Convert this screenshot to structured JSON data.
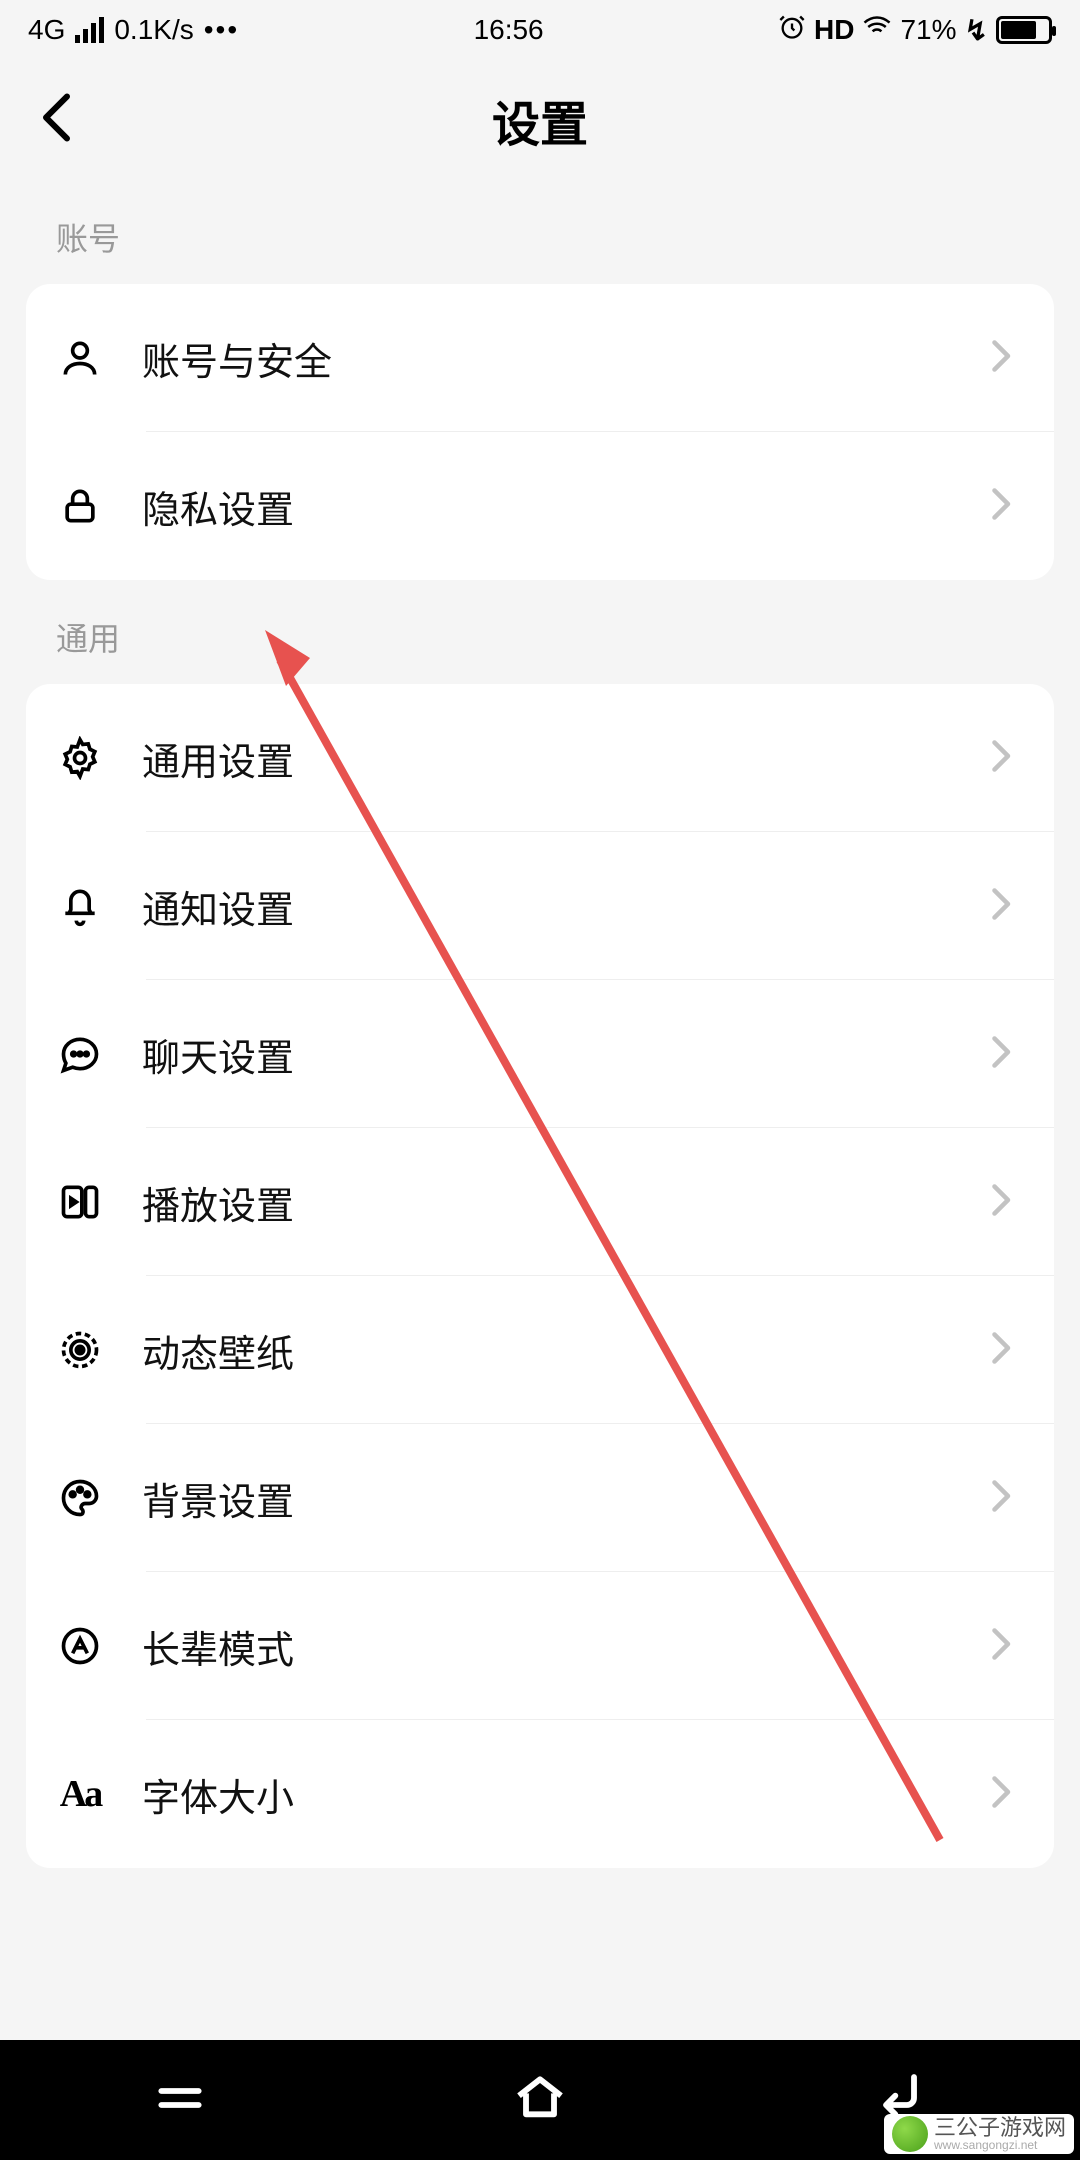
{
  "statusbar": {
    "network": "4G",
    "speed": "0.1K/s",
    "time": "16:56",
    "hd": "HD",
    "battery_pct": "71%"
  },
  "header": {
    "title": "设置"
  },
  "sections": {
    "account": {
      "label": "账号",
      "items": [
        {
          "label": "账号与安全"
        },
        {
          "label": "隐私设置"
        }
      ]
    },
    "general": {
      "label": "通用",
      "items": [
        {
          "label": "通用设置"
        },
        {
          "label": "通知设置"
        },
        {
          "label": "聊天设置"
        },
        {
          "label": "播放设置"
        },
        {
          "label": "动态壁纸"
        },
        {
          "label": "背景设置"
        },
        {
          "label": "长辈模式"
        },
        {
          "label": "字体大小"
        }
      ]
    }
  },
  "watermark": {
    "main": "三公子游戏网",
    "sub": "www.sangongzi.net"
  }
}
